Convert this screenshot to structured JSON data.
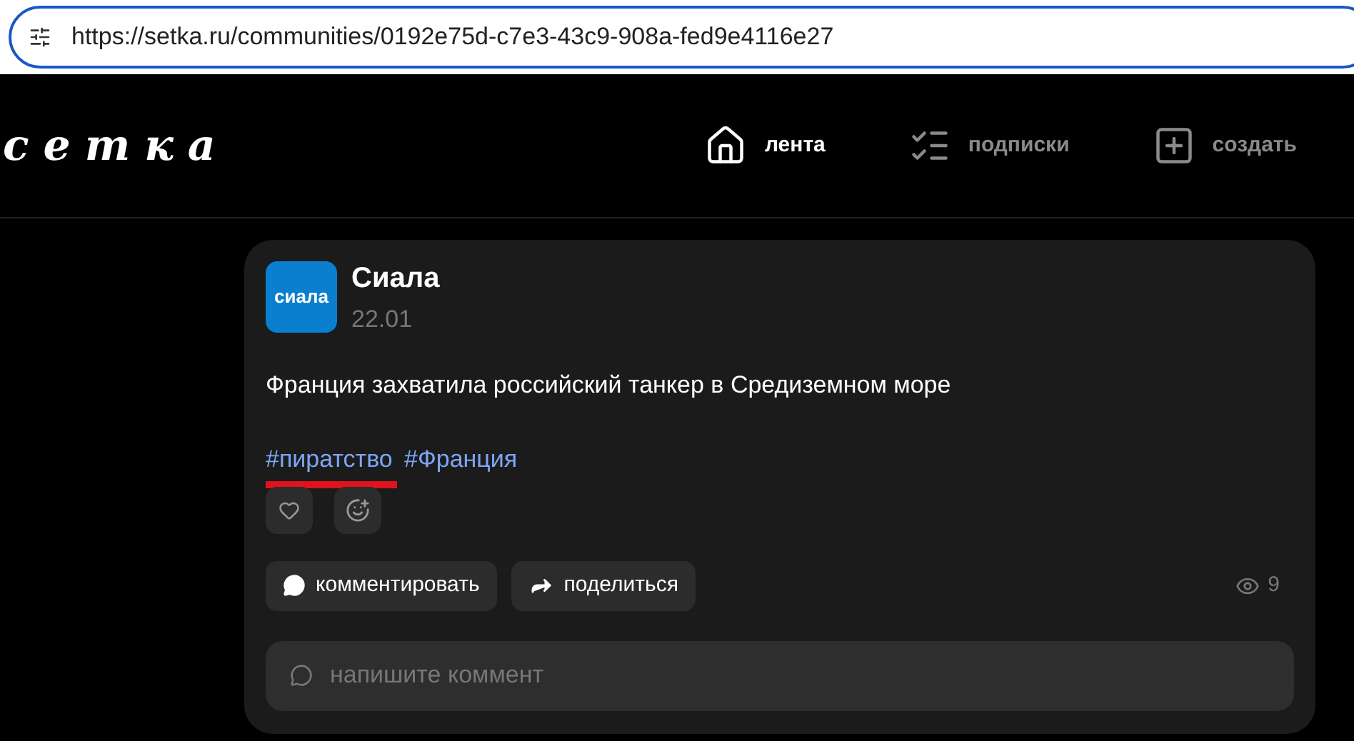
{
  "address_bar": {
    "url": "https://setka.ru/communities/0192e75d-c7e3-43c9-908a-fed9e4116e27"
  },
  "header": {
    "logo": "сетка",
    "nav": [
      {
        "kind": "home",
        "label": "лента",
        "selected": true
      },
      {
        "kind": "subscriptions",
        "label": "подписки",
        "selected": false
      },
      {
        "kind": "create",
        "label": "создать",
        "selected": false
      }
    ]
  },
  "post": {
    "avatar": "сиала",
    "author": "Сиала",
    "date": "22.01",
    "text": "Франция захватила российский танкер в Средиземном море",
    "hashtags": [
      {
        "label": "#пиратство",
        "highlighted": true
      },
      {
        "label": "#Франция",
        "highlighted": false
      }
    ],
    "actions": [
      {
        "kind": "comment",
        "label": "комментировать"
      },
      {
        "kind": "share",
        "label": "поделиться"
      }
    ],
    "views": "9",
    "comment_field": {
      "placeholder": "напишите коммент"
    }
  }
}
